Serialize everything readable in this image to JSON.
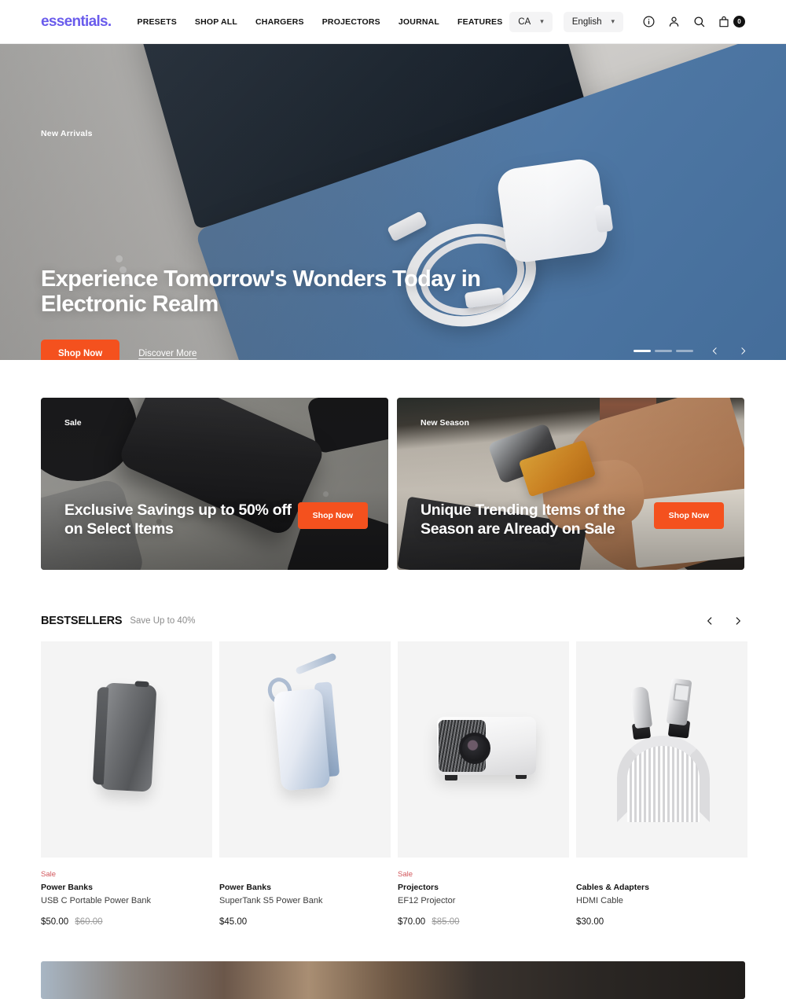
{
  "header": {
    "logo": "essentials.",
    "nav": [
      {
        "label": "PRESETS"
      },
      {
        "label": "SHOP ALL"
      },
      {
        "label": "CHARGERS"
      },
      {
        "label": "PROJECTORS"
      },
      {
        "label": "JOURNAL"
      },
      {
        "label": "FEATURES"
      }
    ],
    "country_select": {
      "value": "CA"
    },
    "language_select": {
      "value": "English"
    },
    "icons": {
      "info": "info-icon",
      "account": "account-icon",
      "search": "search-icon",
      "cart": "cart-icon"
    },
    "cart_count": "0"
  },
  "hero": {
    "eyebrow": "New Arrivals",
    "title": "Experience Tomorrow's Wonders Today in Electronic Realm",
    "primary_button": "Shop Now",
    "secondary_link": "Discover More",
    "slides_total": 3,
    "active_slide": 1,
    "prev_label": "Previous slide",
    "next_label": "Next slide"
  },
  "promos": [
    {
      "tag": "Sale",
      "title": "Exclusive Savings up to 50% off on Select Items",
      "button": "Shop Now"
    },
    {
      "tag": "New Season",
      "title": "Unique Trending Items of the Season are Already on Sale",
      "button": "Shop Now"
    }
  ],
  "bestsellers": {
    "title": "BESTSELLERS",
    "subtitle": "Save Up to 40%",
    "products": [
      {
        "badge": "Sale",
        "category": "Power Banks",
        "name": "USB C Portable Power Bank",
        "price": "$50.00",
        "price_old": "$60.00"
      },
      {
        "badge": "",
        "category": "Power Banks",
        "name": "SuperTank S5 Power Bank",
        "price": "$45.00",
        "price_old": ""
      },
      {
        "badge": "Sale",
        "category": "Projectors",
        "name": "EF12 Projector",
        "price": "$70.00",
        "price_old": "$85.00"
      },
      {
        "badge": "",
        "category": "Cables & Adapters",
        "name": "HDMI Cable",
        "price": "$30.00",
        "price_old": ""
      }
    ]
  },
  "colors": {
    "brand_purple": "#6a5cec",
    "accent_orange": "#f4511e",
    "sale_red": "#d2565b",
    "text_dark": "#141414"
  }
}
